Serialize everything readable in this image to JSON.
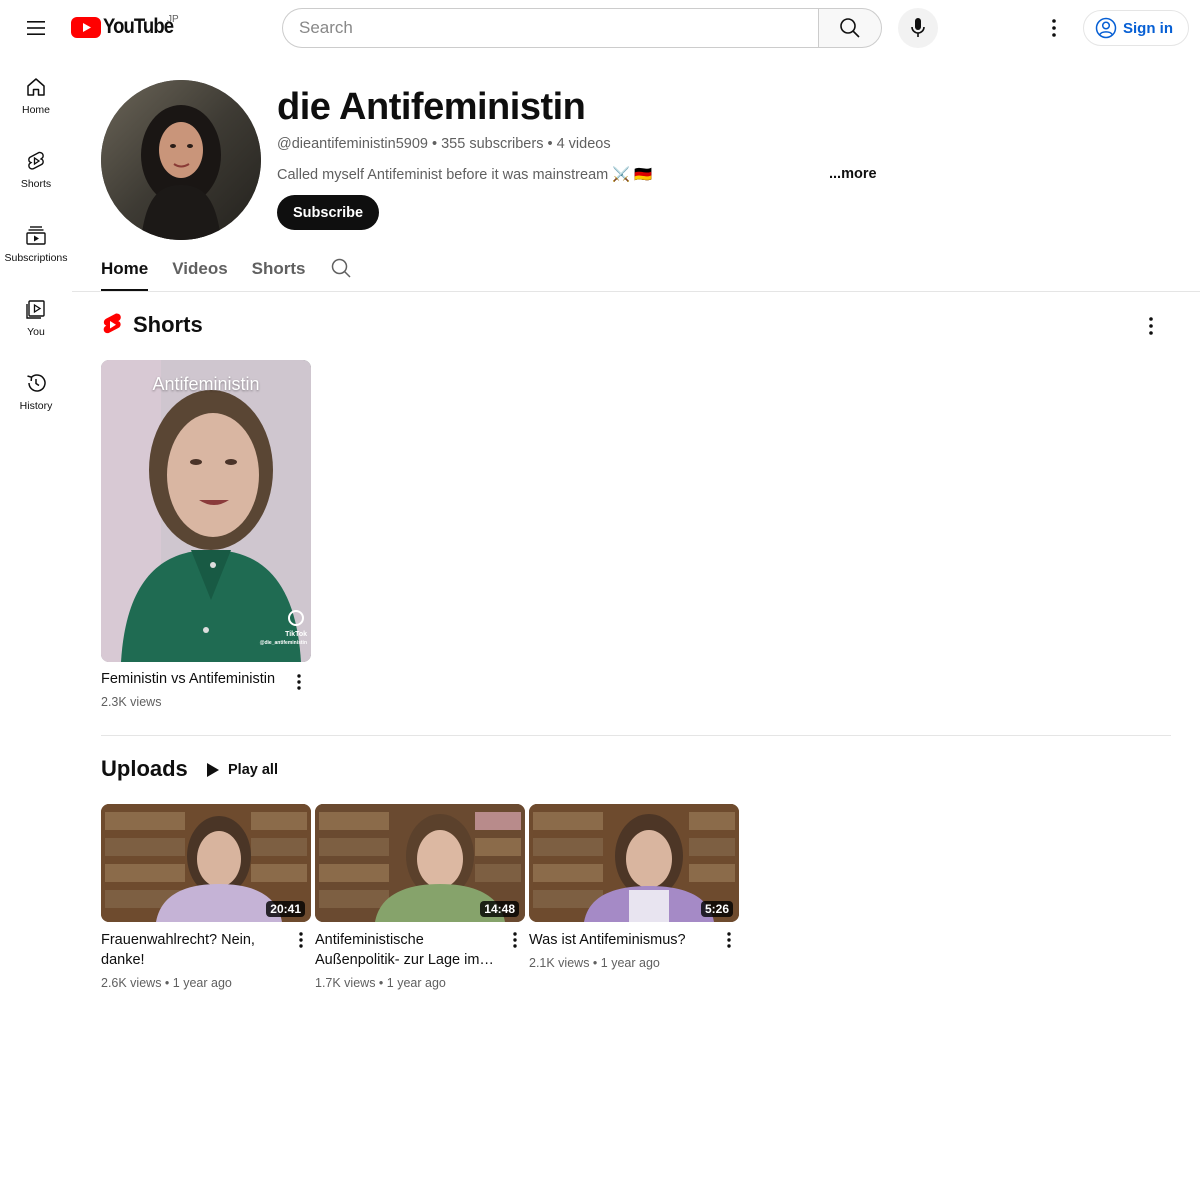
{
  "masthead": {
    "logo_text": "YouTube",
    "region": "JP",
    "search_placeholder": "Search",
    "signin_label": "Sign in",
    "brand_red": "#ff0000",
    "link_blue": "#065fd4"
  },
  "guide": {
    "items": [
      {
        "label": "Home",
        "icon": "home-icon"
      },
      {
        "label": "Shorts",
        "icon": "shorts-icon"
      },
      {
        "label": "Subscriptions",
        "icon": "subscriptions-icon"
      },
      {
        "label": "You",
        "icon": "you-icon"
      },
      {
        "label": "History",
        "icon": "history-icon"
      }
    ]
  },
  "channel": {
    "name": "die Antifeministin",
    "handle": "@dieantifeministin5909",
    "subscribers": "355 subscribers",
    "videos_count": "4 videos",
    "meta_separator": " • ",
    "description": "Called myself Antifeminist before it was mainstream ⚔️ 🇩🇪",
    "more_label": "...more",
    "subscribe_label": "Subscribe"
  },
  "tabs": [
    {
      "label": "Home",
      "active": true
    },
    {
      "label": "Videos",
      "active": false
    },
    {
      "label": "Shorts",
      "active": false
    }
  ],
  "shorts_shelf": {
    "title": "Shorts",
    "items": [
      {
        "overlay_text": "Antifeministin",
        "title": "Feministin vs Antifeministin",
        "views": "2.3K views",
        "watermark": "TikTok",
        "watermark_handle": "@die_antifeministin"
      }
    ]
  },
  "uploads": {
    "title": "Uploads",
    "play_all_label": "Play all",
    "videos": [
      {
        "title": "Frauenwahlrecht? Nein, danke!",
        "duration": "20:41",
        "views": "2.6K views",
        "age": "1 year ago"
      },
      {
        "title": "Antifeministische Außenpolitik- zur Lage im Nahost-Konflikt",
        "duration": "14:48",
        "views": "1.7K views",
        "age": "1 year ago"
      },
      {
        "title": "Was ist Antifeminismus?",
        "duration": "5:26",
        "views": "2.1K views",
        "age": "1 year ago"
      }
    ],
    "meta_separator": " • "
  }
}
